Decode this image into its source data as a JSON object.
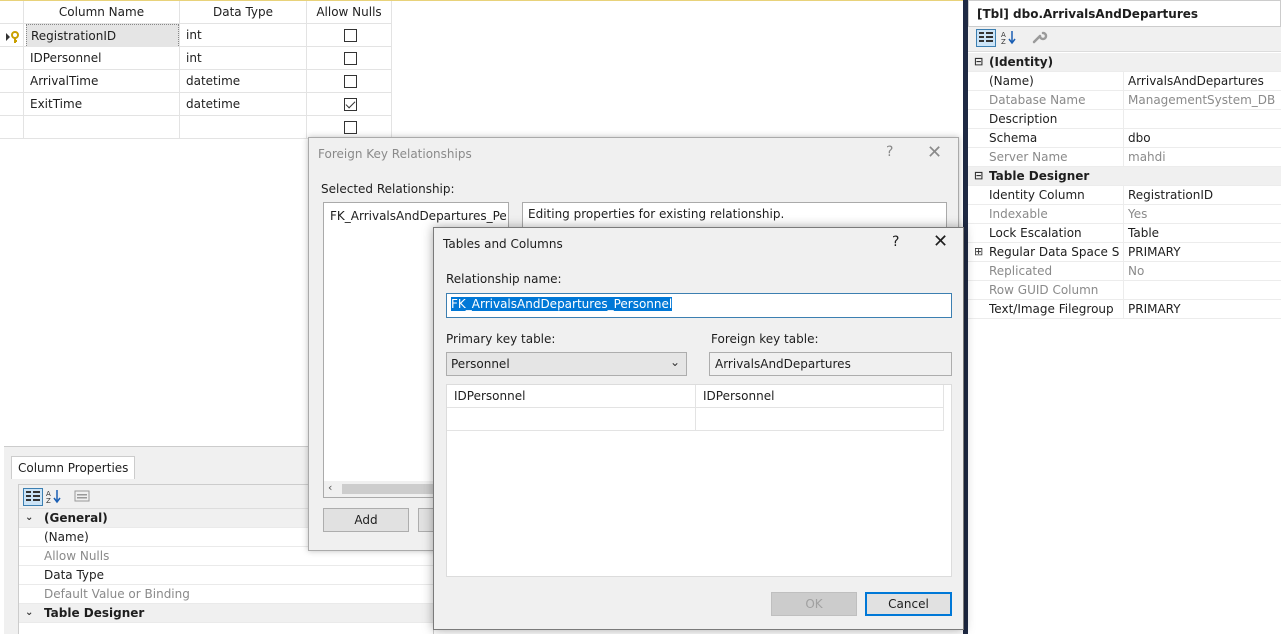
{
  "designer": {
    "headers": [
      "Column Name",
      "Data Type",
      "Allow Nulls"
    ],
    "rows": [
      {
        "name": "RegistrationID",
        "type": "int",
        "nulls": false
      },
      {
        "name": "IDPersonnel",
        "type": "int",
        "nulls": false
      },
      {
        "name": "ArrivalTime",
        "type": "datetime",
        "nulls": false
      },
      {
        "name": "ExitTime",
        "type": "datetime",
        "nulls": true
      },
      {
        "name": "",
        "type": "",
        "nulls": false
      }
    ]
  },
  "column_properties": {
    "tab": "Column Properties",
    "rows": [
      {
        "label": "(General)",
        "category": true
      },
      {
        "label": "(Name)"
      },
      {
        "label": "Allow Nulls",
        "gray": true
      },
      {
        "label": "Data Type"
      },
      {
        "label": "Default Value or Binding",
        "gray": true
      },
      {
        "label": "Table Designer",
        "category": true
      }
    ]
  },
  "properties": {
    "title": "[Tbl] dbo.ArrivalsAndDepartures",
    "rows": [
      {
        "key": "(Identity)",
        "category": true
      },
      {
        "key": "(Name)",
        "value": "ArrivalsAndDepartures"
      },
      {
        "key": "Database Name",
        "value": "ManagementSystem_DB",
        "gray": true
      },
      {
        "key": "Description",
        "value": ""
      },
      {
        "key": "Schema",
        "value": "dbo"
      },
      {
        "key": "Server Name",
        "value": "mahdi",
        "gray": true
      },
      {
        "key": "Table Designer",
        "category": true
      },
      {
        "key": "Identity Column",
        "value": "RegistrationID"
      },
      {
        "key": "Indexable",
        "value": "Yes",
        "gray": true
      },
      {
        "key": "Lock Escalation",
        "value": "Table"
      },
      {
        "key": "Regular Data Space Spec",
        "value": "PRIMARY",
        "expandable": true
      },
      {
        "key": "Replicated",
        "value": "No",
        "gray": true
      },
      {
        "key": "Row GUID Column",
        "value": "",
        "gray": true
      },
      {
        "key": "Text/Image Filegroup",
        "value": "PRIMARY"
      }
    ]
  },
  "fk_dialog": {
    "title": "Foreign Key Relationships",
    "help": "?",
    "close": "✕",
    "selected_label": "Selected Relationship:",
    "selected_item": "FK_ArrivalsAndDepartures_Personnel",
    "description": "Editing properties for existing relationship.",
    "add_button": "Add"
  },
  "tc_dialog": {
    "title": "Tables and Columns",
    "help": "?",
    "close": "✕",
    "relationship_label": "Relationship name:",
    "relationship_name": "FK_ArrivalsAndDepartures_Personnel",
    "pk_label": "Primary key table:",
    "fk_label": "Foreign key table:",
    "pk_table": "Personnel",
    "fk_table": "ArrivalsAndDepartures",
    "columns": [
      {
        "pk": "IDPersonnel",
        "fk": "IDPersonnel"
      },
      {
        "pk": "",
        "fk": ""
      }
    ],
    "ok_button": "OK",
    "cancel_button": "Cancel"
  }
}
